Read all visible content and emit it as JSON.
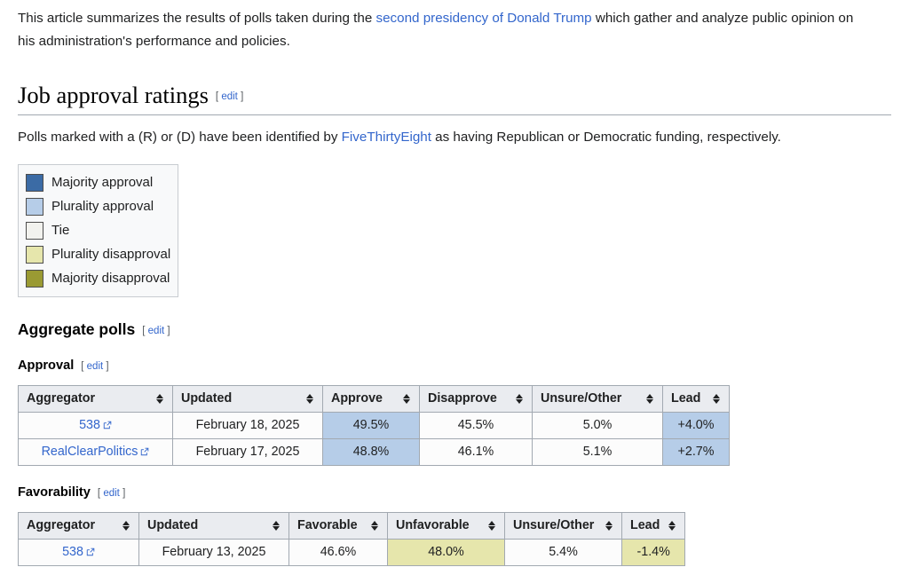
{
  "intro": {
    "text_before": "This article summarizes the results of polls taken during the ",
    "link_text": "second presidency of Donald Trump",
    "text_after": " which gather and analyze public opinion on his administration's performance and policies."
  },
  "section": {
    "title": "Job approval ratings",
    "edit_label": "edit",
    "edit_open": "[",
    "edit_close": "]"
  },
  "note": {
    "text_before": "Polls marked with a (R) or (D) have been identified by ",
    "link_text": "FiveThirtyEight",
    "text_after": " as having Republican or Democratic funding, respectively."
  },
  "legend": {
    "items": [
      {
        "label": "Majority approval",
        "color": "#3b6ba5"
      },
      {
        "label": "Plurality approval",
        "color": "#b6cde8"
      },
      {
        "label": "Tie",
        "color": "#f2f2ee"
      },
      {
        "label": "Plurality disapproval",
        "color": "#e6e6ac"
      },
      {
        "label": "Majority disapproval",
        "color": "#9a9a33"
      }
    ]
  },
  "aggregate": {
    "heading": "Aggregate polls",
    "edit_label": "edit"
  },
  "approval": {
    "heading": "Approval",
    "edit_label": "edit",
    "columns": [
      "Aggregator",
      "Updated",
      "Approve",
      "Disapprove",
      "Unsure/Other",
      "Lead"
    ],
    "rows": [
      {
        "aggregator": "538",
        "aggregator_icon": "external-link-icon",
        "updated": "February 18, 2025",
        "approve": "49.5%",
        "disapprove": "45.5%",
        "unsure": "5.0%",
        "lead": "+4.0%",
        "approve_color": "#b6cde8",
        "lead_color": "#b6cde8"
      },
      {
        "aggregator": "RealClearPolitics",
        "aggregator_icon": "external-link-icon",
        "updated": "February 17, 2025",
        "approve": "48.8%",
        "disapprove": "46.1%",
        "unsure": "5.1%",
        "lead": "+2.7%",
        "approve_color": "#b6cde8",
        "lead_color": "#b6cde8"
      }
    ]
  },
  "favorability": {
    "heading": "Favorability",
    "edit_label": "edit",
    "columns": [
      "Aggregator",
      "Updated",
      "Favorable",
      "Unfavorable",
      "Unsure/Other",
      "Lead"
    ],
    "rows": [
      {
        "aggregator": "538",
        "aggregator_icon": "external-link-icon",
        "updated": "February 13, 2025",
        "favorable": "46.6%",
        "unfavorable": "48.0%",
        "unsure": "5.4%",
        "lead": "-1.4%",
        "unfavorable_color": "#e6e6ac",
        "lead_color": "#e6e6ac"
      }
    ]
  },
  "colors": {
    "link": "#3366cc",
    "header_bg": "#eaecf0",
    "border": "#a2a9b1"
  }
}
